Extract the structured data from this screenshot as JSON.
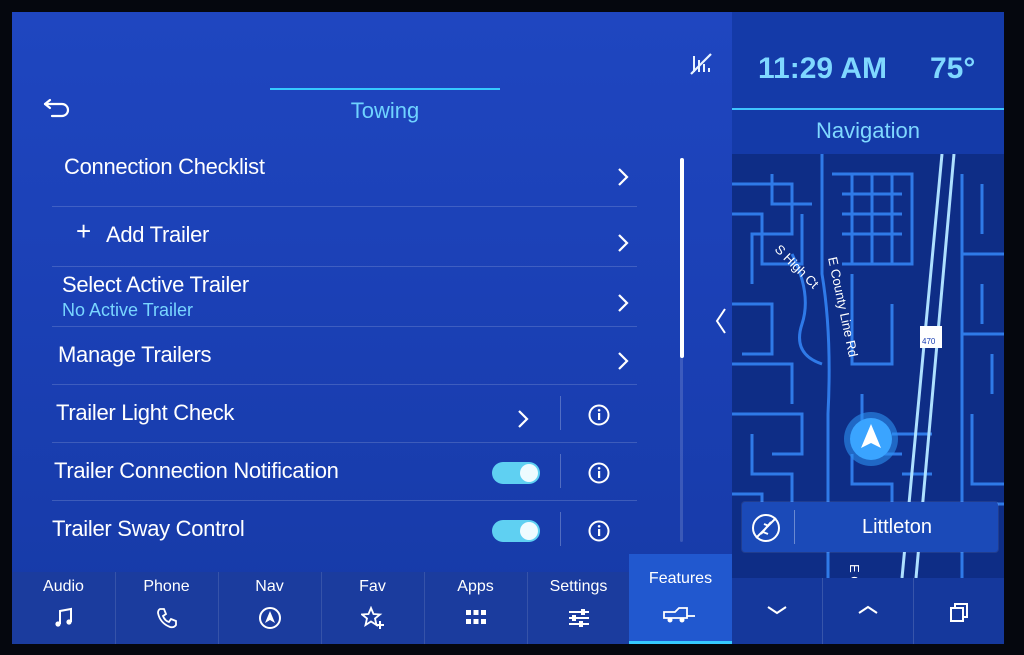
{
  "header": {
    "title": "Towing"
  },
  "menu": {
    "items": [
      {
        "label": "Connection Checklist"
      },
      {
        "label": "Add Trailer",
        "prefix": "+"
      },
      {
        "label": "Select Active Trailer",
        "sublabel": "No Active Trailer"
      },
      {
        "label": "Manage Trailers"
      },
      {
        "label": "Trailer Light Check"
      },
      {
        "label": "Trailer Connection Notification",
        "toggle": true
      },
      {
        "label": "Trailer Sway Control",
        "toggle": true
      }
    ]
  },
  "status": {
    "time": "11:29 AM",
    "temperature": "75°"
  },
  "navigation": {
    "title": "Navigation",
    "destination": "Littleton",
    "map_labels": [
      "S High Ct",
      "E County Line Rd",
      "470",
      "E C"
    ]
  },
  "bottom_tabs": [
    {
      "label": "Audio",
      "icon": "music-note-icon"
    },
    {
      "label": "Phone",
      "icon": "phone-icon"
    },
    {
      "label": "Nav",
      "icon": "nav-arrow-icon"
    },
    {
      "label": "Fav",
      "icon": "star-plus-icon"
    },
    {
      "label": "Apps",
      "icon": "apps-grid-icon"
    },
    {
      "label": "Settings",
      "icon": "sliders-icon"
    },
    {
      "label": "Features",
      "icon": "truck-trailer-icon",
      "active": true
    }
  ],
  "colors": {
    "accent": "#36c9ff",
    "background": "#1a3fb3",
    "toggle_on": "#5fd0f2"
  }
}
